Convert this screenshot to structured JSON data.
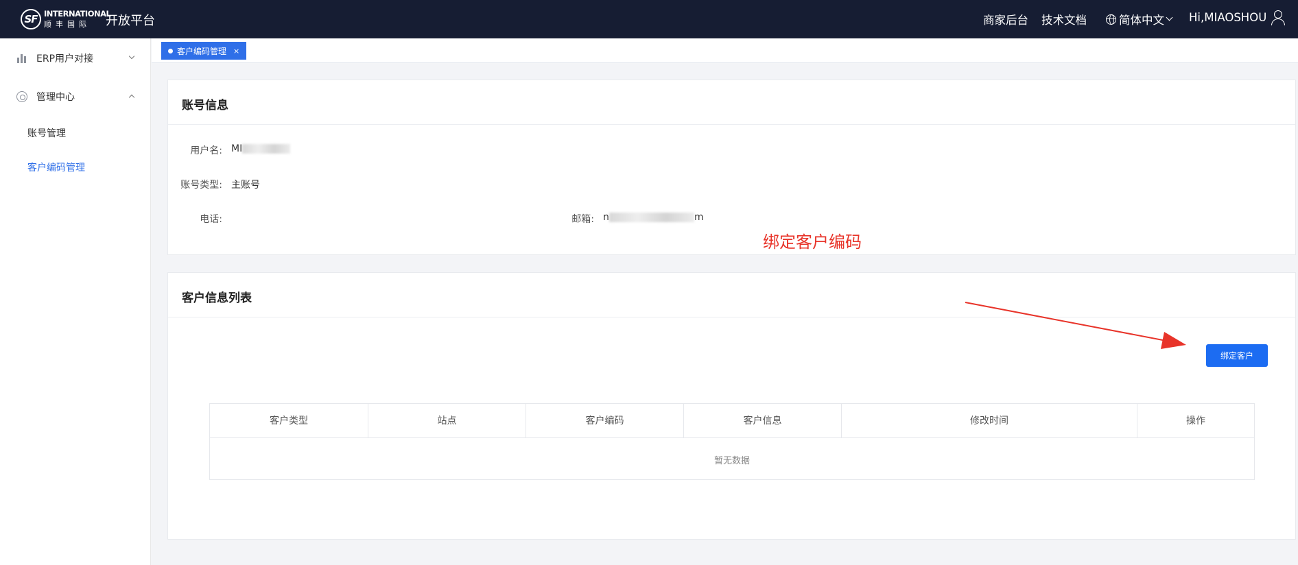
{
  "header": {
    "logo": {
      "en": "INTERNATIONAL",
      "cn": "顺丰国际",
      "mark": "SF"
    },
    "platform_title": "开放平台",
    "merchant_link": "商家后台",
    "docs_link": "技术文档",
    "language": "简体中文",
    "greeting": "Hi,MIAOSHOU"
  },
  "sidebar": {
    "erp": "ERP用户对接",
    "management": "管理中心",
    "account_mgmt": "账号管理",
    "customer_code_mgmt": "客户编码管理"
  },
  "tabs": [
    {
      "label": "客户编码管理",
      "close": "×"
    }
  ],
  "account_info": {
    "title": "账号信息",
    "username_label": "用户名:",
    "username_value": "MI",
    "type_label": "账号类型:",
    "type_value": "主账号",
    "phone_label": "电话:",
    "email_label": "邮箱:",
    "email_prefix": "n",
    "email_suffix": "m"
  },
  "annotation": "绑定客户编码",
  "customer_list": {
    "title": "客户信息列表",
    "bind_button": "绑定客户",
    "columns": [
      "客户类型",
      "站点",
      "客户编码",
      "客户信息",
      "修改时间",
      "操作"
    ],
    "empty_text": "暂无数据"
  },
  "colors": {
    "topbar": "#161d33",
    "primary": "#2f6fe8",
    "annotation": "#e8342a"
  }
}
